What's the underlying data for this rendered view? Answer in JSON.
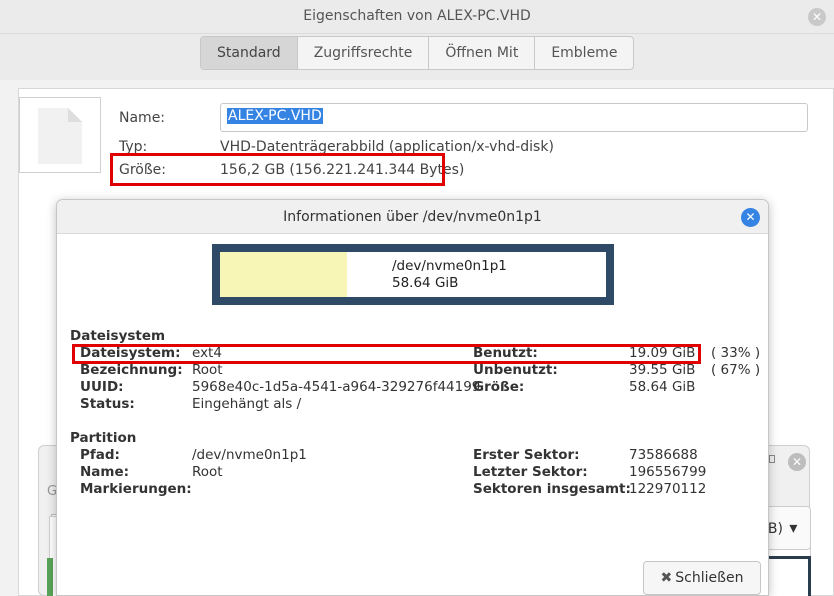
{
  "properties_window": {
    "title": "Eigenschaften von ALEX-PC.VHD",
    "tabs": [
      "Standard",
      "Zugriffsrechte",
      "Öffnen Mit",
      "Embleme"
    ],
    "name_label": "Name:",
    "name_value": "ALEX-PC.VHD",
    "type_label": "Typ:",
    "type_value": "VHD-Datenträgerabbild (application/x-vhd-disk)",
    "size_label": "Größe:",
    "size_value": "156,2 GB (156.221.241.344 Bytes)"
  },
  "background_dialog": {
    "letter": "G",
    "combo_text": "iB)",
    "combo_arrow": "▾"
  },
  "info_dialog": {
    "title": "Informationen über /dev/nvme0n1p1",
    "usage": {
      "device": "/dev/nvme0n1p1",
      "capacity": "58.64 GiB",
      "used_fraction": 0.33
    },
    "filesystem_section": {
      "title": "Dateisystem",
      "left": [
        {
          "label": "Dateisystem:",
          "value": "ext4"
        },
        {
          "label": "Bezeichnung:",
          "value": "Root"
        },
        {
          "label": "UUID:",
          "value": "5968e40c-1d5a-4541-a964-329276f44199"
        },
        {
          "label": "Status:",
          "value": "Eingehängt als /"
        }
      ],
      "right": [
        {
          "label": "Benutzt:",
          "value": "19.09 GiB",
          "percent": "( 33% )"
        },
        {
          "label": "Unbenutzt:",
          "value": "39.55 GiB",
          "percent": "( 67% )"
        },
        {
          "label": "Größe:",
          "value": "58.64 GiB",
          "percent": ""
        }
      ]
    },
    "partition_section": {
      "title": "Partition",
      "left": [
        {
          "label": "Pfad:",
          "value": "/dev/nvme0n1p1"
        },
        {
          "label": "Name:",
          "value": "Root"
        },
        {
          "label": "Markierungen:",
          "value": ""
        }
      ],
      "right": [
        {
          "label": "Erster Sektor:",
          "value": "73586688"
        },
        {
          "label": "Letzter Sektor:",
          "value": "196556799"
        },
        {
          "label": "Sektoren insgesamt:",
          "value": "122970112"
        }
      ]
    },
    "close_button": {
      "icon": "✖",
      "label": "Schließen"
    }
  },
  "colors": {
    "highlight_red": "#e10000",
    "usage_frame": "#2f4a66",
    "usage_fill": "#f7f6b7",
    "accent_blue": "#3584e4"
  }
}
